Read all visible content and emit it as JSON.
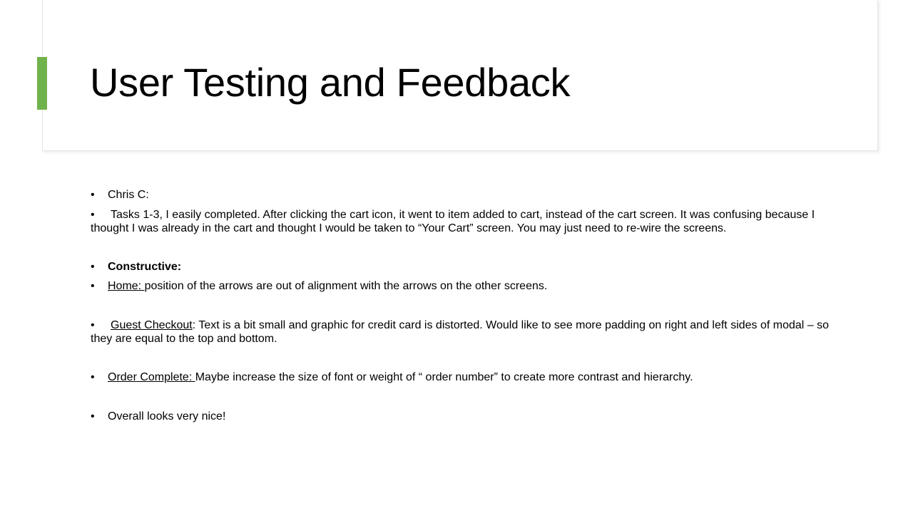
{
  "slide": {
    "title": "User Testing and Feedback",
    "accent_color": "#70b24b"
  },
  "bullets": {
    "symbol": "•",
    "tester": "Chris C:",
    "tasks": "Tasks 1-3, I easily completed. After clicking the cart icon, it went to item added to cart, instead of the cart screen. It was confusing because I thought I was already in the cart and thought I would be taken to “Your Cart” screen. You may just need to re-wire the screens.",
    "constructive_heading": "Constructive:",
    "home_label": "Home: ",
    "home_text": "position of the arrows are out of alignment with the arrows on the other screens.",
    "guest_label": "Guest Checkout",
    "guest_text": ": Text is a bit small and graphic for credit card is distorted. Would like to see more padding on right and left sides of modal – so they are equal to the top and bottom.",
    "order_label": "Order Complete: ",
    "order_text": "Maybe increase the size of font or weight of “ order number” to create more contrast and hierarchy.",
    "overall": "Overall looks very nice!"
  }
}
